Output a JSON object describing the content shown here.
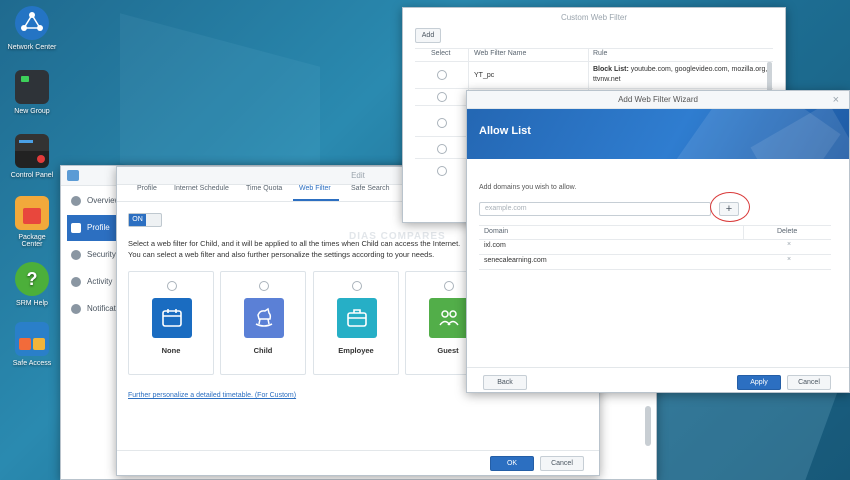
{
  "desktop": {
    "icons": [
      {
        "label": "Network Center"
      },
      {
        "label": "New Group"
      },
      {
        "label": "Control Panel"
      },
      {
        "label": "Package Center"
      },
      {
        "label": "SRM Help"
      },
      {
        "label": "Safe Access"
      }
    ]
  },
  "profile_window": {
    "sidebar": [
      {
        "label": "Overview"
      },
      {
        "label": "Profile"
      },
      {
        "label": "Security"
      },
      {
        "label": "Activity"
      },
      {
        "label": "Notifications"
      }
    ]
  },
  "edit_window": {
    "title": "Edit",
    "tabs": [
      {
        "label": "Profile"
      },
      {
        "label": "Internet Schedule"
      },
      {
        "label": "Time Quota"
      },
      {
        "label": "Web Filter"
      },
      {
        "label": "Safe Search"
      }
    ],
    "toggle_label": "ON",
    "description": "Select a web filter for Child, and it will be applied to all the times when Child can access the Internet. You can select a web filter and also further personalize the settings according to your needs.",
    "filters": [
      {
        "label": "None",
        "color": "#1a6cc1"
      },
      {
        "label": "Child",
        "color": "#5b80d6"
      },
      {
        "label": "Employee",
        "color": "#26afc6"
      },
      {
        "label": "Guest",
        "color": "#52ae49"
      }
    ],
    "link_text": "Further personalize a detailed timetable. (For Custom)",
    "watermark": "DIAS COMPARES",
    "ok_label": "OK",
    "cancel_label": "Cancel"
  },
  "custom_filter_window": {
    "title": "Custom Web Filter",
    "add_label": "Add",
    "headers": {
      "select": "Select",
      "name": "Web Filter Name",
      "rule": "Rule"
    },
    "rows": [
      {
        "name": "YT_pc",
        "rule_title": "Block List:",
        "rule_text": "youtube.com, googlevideo.com, mozilla.org, ttvnw.net"
      }
    ]
  },
  "wizard": {
    "title": "Add Web Filter Wizard",
    "banner_title": "Allow List",
    "instruction": "Add domains you wish to allow.",
    "input_placeholder": "example.com",
    "add_symbol": "+",
    "headers": {
      "domain": "Domain",
      "delete": "Delete"
    },
    "domains": [
      {
        "domain": "ixl.com"
      },
      {
        "domain": "senecalearning.com"
      }
    ],
    "delete_symbol": "×",
    "close_symbol": "×",
    "back_label": "Back",
    "apply_label": "Apply",
    "cancel_label": "Cancel",
    "accent": "#2c6fc1"
  }
}
